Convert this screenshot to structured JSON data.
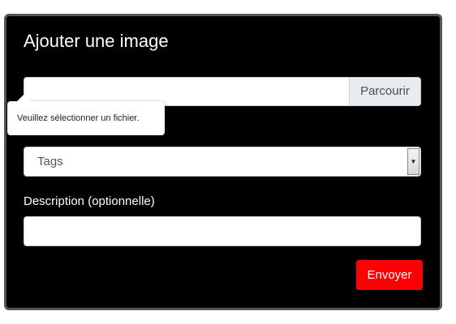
{
  "form": {
    "title": "Ajouter une image",
    "file": {
      "value": "",
      "browse_label": "Parcourir",
      "validation_message": "Veuillez sélectionner un fichier."
    },
    "tags": {
      "selected": "Tags",
      "arrow_icon": "triangle-down-icon"
    },
    "description": {
      "label": "Description (optionnelle)",
      "value": ""
    },
    "submit_label": "Envoyer"
  },
  "colors": {
    "panel_background": "#000000",
    "panel_border": "#555555",
    "submit_background": "#ff0000",
    "browse_background": "#e9ecef"
  }
}
